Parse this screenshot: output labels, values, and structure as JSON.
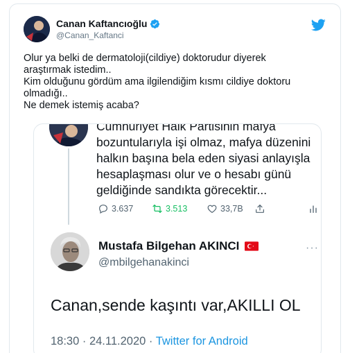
{
  "tweet": {
    "display_name": "Canan Kaftancıoğlu",
    "handle": "@Canan_Kaftanci",
    "verified_icon": "verified-badge-icon",
    "platform_icon": "twitter-bird-icon",
    "text_lines": [
      "Olur ya belki de dermatoloji(cildiye) doktorudur diyerek",
      "araştırmak istedim..",
      "Kim olduğunu gördüm ama ilgilendiğim kısmı cildiye doktoru",
      "olmadığı..",
      "Ne demek istemiş acaba?"
    ]
  },
  "embed": {
    "quoted_text_lines": [
      "Cumhuriyet Halk Partisinin mafya",
      "bozuntularıyla işi olmaz, mafya düzenini",
      "halkın başına bela eden siyasi anlayışla",
      "hesaplaşması olur ve o hesabı günü",
      "geldiğinde sandıkta görecektir..."
    ],
    "actions": {
      "replies": "3.637",
      "retweets": "3.513",
      "likes": "33,7B"
    },
    "reply": {
      "display_name": "Mustafa Bilgehan AKINCI",
      "handle": "@mbilgehanakinci",
      "more": "···",
      "text": "Canan,sende kaşıntı var,AKILLI OL",
      "time": "18:30 · 24.11.2020 · ",
      "source": "Twitter for Android"
    }
  },
  "colors": {
    "twitter_blue": "#1da1f2",
    "retweet_green": "#17bf63",
    "secondary_text": "#657786"
  }
}
